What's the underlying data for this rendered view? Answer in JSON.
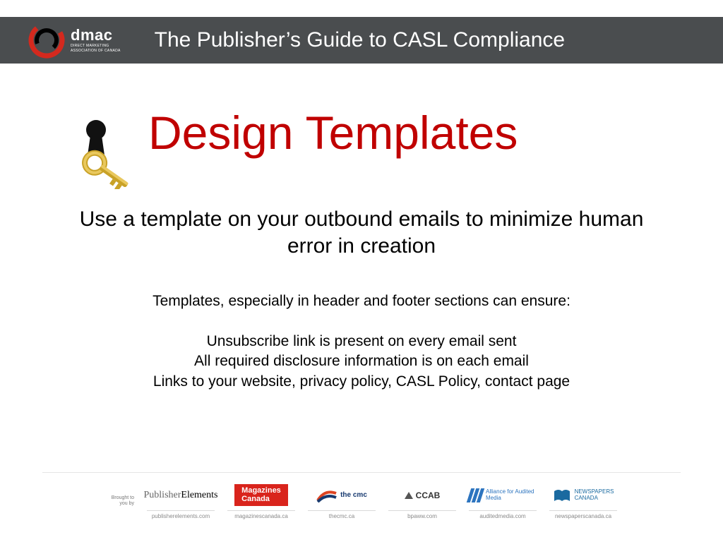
{
  "header": {
    "logo_name": "dmac",
    "logo_sub1": "DIRECT MARKETING",
    "logo_sub2": "ASSOCIATION OF CANADA",
    "title": "The Publisher’s Guide to CASL Compliance"
  },
  "main": {
    "heading": "Design Templates",
    "subheading": "Use a template on your outbound emails to minimize human error in creation",
    "lead_in": "Templates, especially in header and footer sections can ensure:",
    "bullets": [
      "Unsubscribe link is present on every email sent",
      "All required disclosure information is on each email",
      "Links to your website, privacy policy, CASL Policy, contact page"
    ]
  },
  "footer": {
    "brought_by": "Brought to you by",
    "sponsors": [
      {
        "name": "PublisherElements",
        "url": "publisherelements.com"
      },
      {
        "name": "Magazines Canada",
        "url": "magazinescanada.ca"
      },
      {
        "name": "the cmc",
        "url": "thecmc.ca"
      },
      {
        "name": "CCAB",
        "url": "bpaww.com"
      },
      {
        "name": "Alliance for Audited Media",
        "url": "auditedmedia.com"
      },
      {
        "name": "Newspapers Canada",
        "url": "newspaperscanada.ca"
      }
    ]
  }
}
